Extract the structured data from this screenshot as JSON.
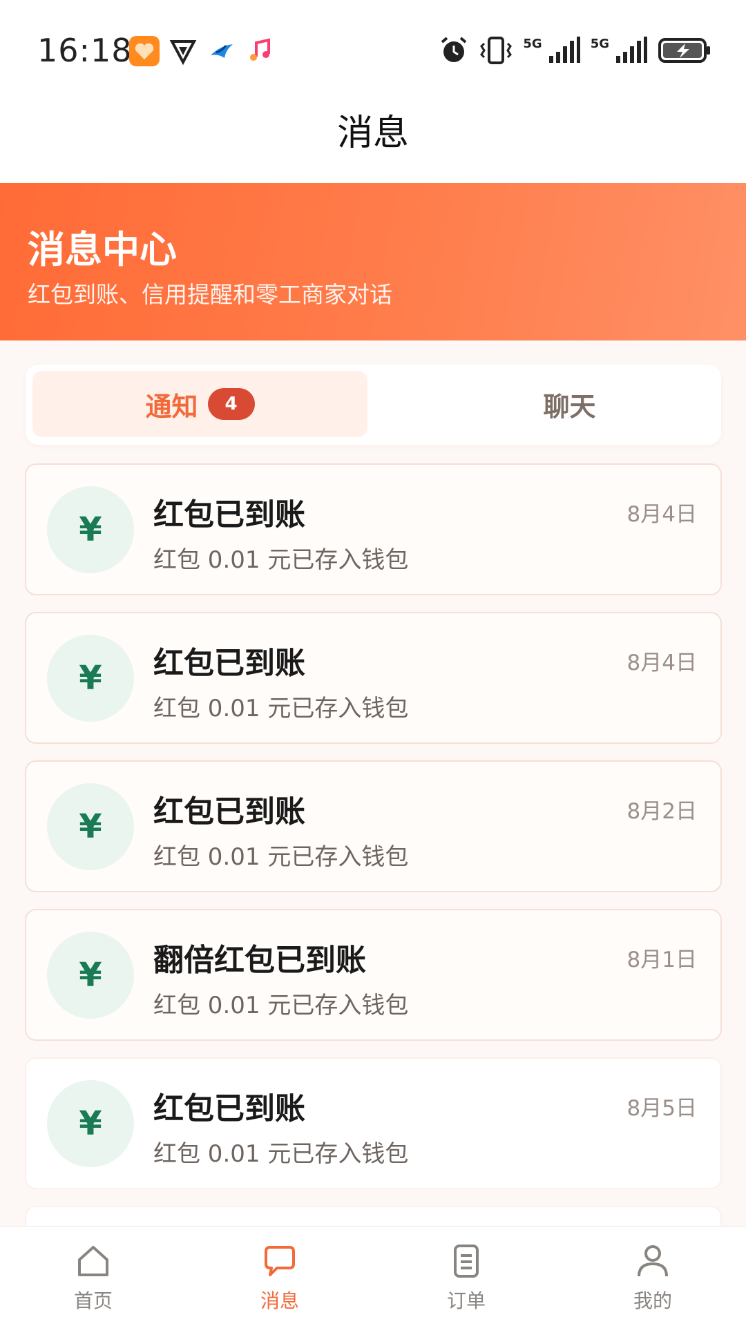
{
  "status_bar": {
    "time": "16:18",
    "signal_1_label": "5G",
    "signal_2_label": "5G",
    "icons": [
      "health-app-icon",
      "vpn-app-icon",
      "bird-app-icon",
      "music-app-icon",
      "alarm-icon",
      "vibrate-icon",
      "signal-icon",
      "signal-icon",
      "battery-charging-icon"
    ]
  },
  "header": {
    "title": "消息"
  },
  "hero": {
    "title": "消息中心",
    "subtitle": "红包到账、信用提醒和零工商家对话"
  },
  "tabs": [
    {
      "label": "通知",
      "badge": "4",
      "active": true
    },
    {
      "label": "聊天",
      "active": false
    }
  ],
  "messages": [
    {
      "title": "红包已到账",
      "body": "红包 0.01 元已存入钱包",
      "date": "8月4日",
      "icon": "yen-coin-icon",
      "icon_glyph": "¥"
    },
    {
      "title": "红包已到账",
      "body": "红包 0.01 元已存入钱包",
      "date": "8月4日",
      "icon": "yen-coin-icon",
      "icon_glyph": "¥"
    },
    {
      "title": "红包已到账",
      "body": "红包 0.01 元已存入钱包",
      "date": "8月2日",
      "icon": "yen-coin-icon",
      "icon_glyph": "¥"
    },
    {
      "title": "翻倍红包已到账",
      "body": "红包 0.01 元已存入钱包",
      "date": "8月1日",
      "icon": "yen-coin-icon",
      "icon_glyph": "¥"
    },
    {
      "title": "红包已到账",
      "body": "红包 0.01 元已存入钱包",
      "date": "8月5日",
      "icon": "yen-coin-icon",
      "icon_glyph": "¥"
    }
  ],
  "bottom_nav": [
    {
      "label": "首页",
      "icon": "home-icon",
      "active": false
    },
    {
      "label": "消息",
      "icon": "chat-bubble-icon",
      "active": true
    },
    {
      "label": "订单",
      "icon": "order-list-icon",
      "active": false
    },
    {
      "label": "我的",
      "icon": "profile-icon",
      "active": false
    }
  ],
  "colors": {
    "accent": "#f26a3a",
    "hero_gradient_start": "#ff6b36",
    "hero_gradient_end": "#ff9066",
    "badge": "#d94a34",
    "coin_bg": "#eaf5f0",
    "coin_glyph": "#1a7a54"
  }
}
